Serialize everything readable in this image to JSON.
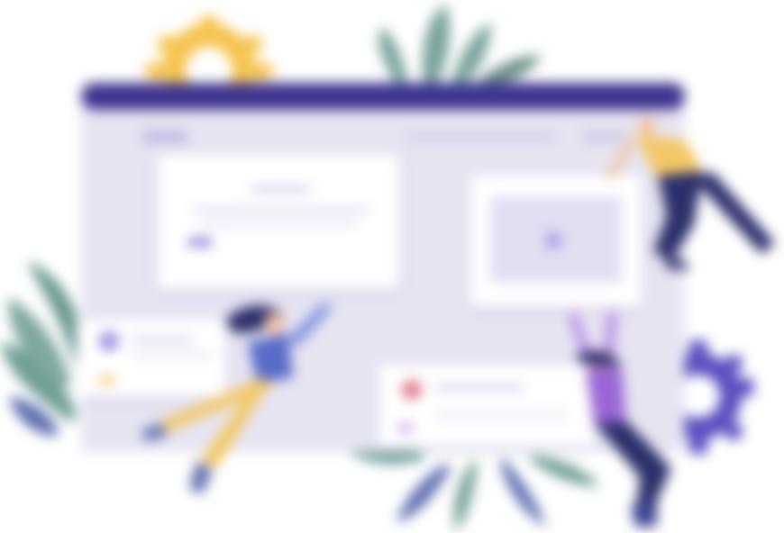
{
  "colors": {
    "window_bar": "#3f3590",
    "window_bg": "#e6e4f1",
    "card_bg": "#ffffff",
    "accent": "#8b80d8",
    "gear_yellow": "#f5c450",
    "gear_purple": "#5a4fc0",
    "leaf_green": "#6f9e96",
    "leaf_blue": "#5f6fb0",
    "figure_yellow": "#f2c866",
    "figure_navy": "#2d2f6b",
    "figure_purple": "#9a66d6"
  },
  "icons": {
    "play": "play-icon",
    "gear_top": "gear-icon",
    "gear_right": "gear-icon"
  }
}
